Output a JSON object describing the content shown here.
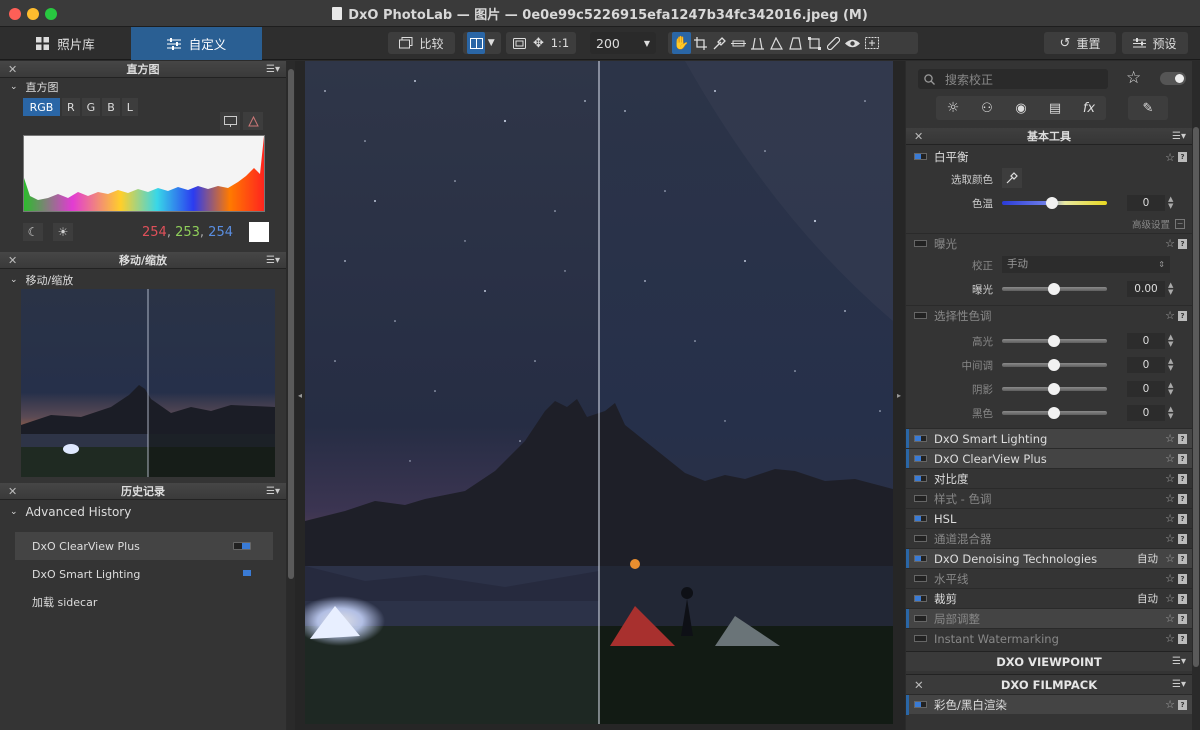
{
  "window": {
    "title": "DxO PhotoLab — 图片 — 0e0e99c5226915efa1247b34fc342016.jpeg (M)"
  },
  "toolbar": {
    "tab_library": "照片库",
    "tab_customize": "自定义",
    "compare_label": "比较",
    "zoom_ratio": "1:1",
    "zoom_value": "200",
    "reset_label": "重置",
    "preset_label": "预设"
  },
  "left": {
    "histogram_panel_title": "直方图",
    "histogram_sub": "直方图",
    "channels": [
      "RGB",
      "R",
      "G",
      "B",
      "L"
    ],
    "rgb_r": "254",
    "rgb_g": "253",
    "rgb_b": "254",
    "move_panel_title": "移动/缩放",
    "move_sub": "移动/缩放",
    "history_panel_title": "历史记录",
    "history_sub": "Advanced History",
    "history_items": [
      "DxO ClearView Plus",
      "DxO Smart Lighting",
      "加载 sidecar"
    ]
  },
  "right": {
    "search_placeholder": "搜索校正",
    "basic_tools_title": "基本工具",
    "white_balance": "白平衡",
    "pick_color": "选取颜色",
    "temperature_label": "色温",
    "temperature_value": "0",
    "advanced_settings": "高级设置",
    "exposure": "曝光",
    "correction_label": "校正",
    "correction_value": "手动",
    "exposure_label": "曝光",
    "exposure_value": "0.00",
    "selective_tone": "选择性色调",
    "highlights_label": "高光",
    "highlights_value": "0",
    "midtones_label": "中间调",
    "midtones_value": "0",
    "shadows_label": "阴影",
    "shadows_value": "0",
    "blacks_label": "黑色",
    "blacks_value": "0",
    "tools": [
      {
        "name": "DxO Smart Lighting",
        "auto": ""
      },
      {
        "name": "DxO ClearView Plus",
        "auto": ""
      },
      {
        "name": "对比度",
        "auto": ""
      },
      {
        "name": "样式 - 色调",
        "auto": ""
      },
      {
        "name": "HSL",
        "auto": ""
      },
      {
        "name": "通道混合器",
        "auto": ""
      },
      {
        "name": "DxO Denoising Technologies",
        "auto": "自动"
      },
      {
        "name": "水平线",
        "auto": ""
      },
      {
        "name": "裁剪",
        "auto": "自动"
      },
      {
        "name": "局部调整",
        "auto": ""
      },
      {
        "name": "Instant Watermarking",
        "auto": ""
      }
    ],
    "viewpoint_title": "DXO VIEWPOINT",
    "filmpack_title": "DXO FILMPACK",
    "filmpack_first": "彩色/黑白渲染"
  },
  "colors": {
    "accent": "#2a66a6",
    "panel": "#343434",
    "rgb_r": "#e0505a",
    "rgb_g": "#8fcf5a",
    "rgb_b": "#5a8ee0"
  }
}
